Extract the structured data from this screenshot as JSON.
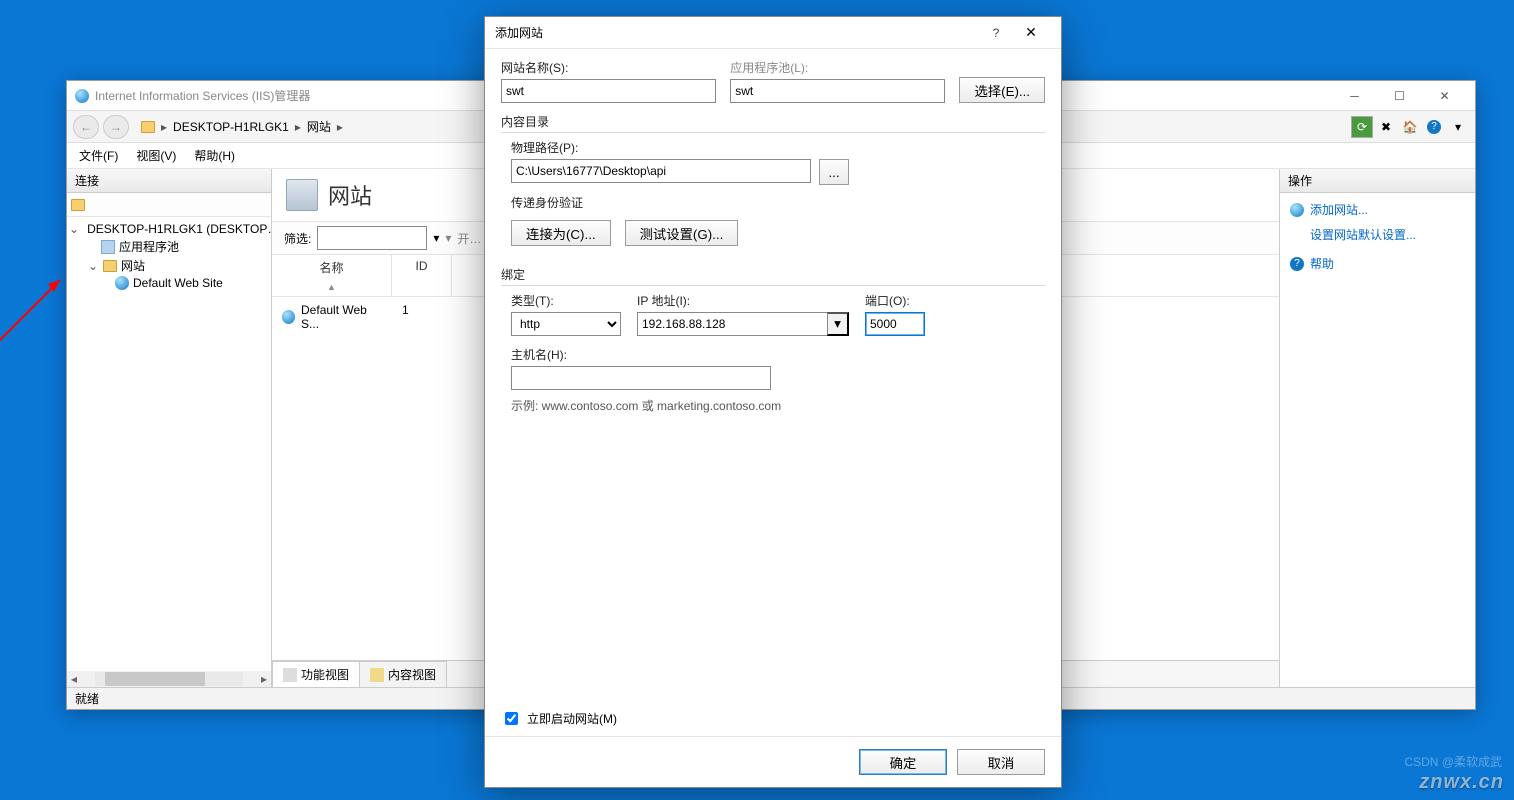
{
  "iis": {
    "title": "Internet Information Services (IIS)管理器",
    "breadcrumb": {
      "host": "DESKTOP-H1RLGK1",
      "node": "网站"
    },
    "menu": {
      "file": "文件(F)",
      "view": "视图(V)",
      "help": "帮助(H)"
    },
    "connections": {
      "header": "连接",
      "host": "DESKTOP-H1RLGK1 (DESKTOP…",
      "appPools": "应用程序池",
      "sites": "网站",
      "defaultSite": "Default Web Site"
    },
    "center": {
      "title": "网站",
      "filterLabel": "筛选:",
      "goLabel": "开…",
      "columns": {
        "name": "名称",
        "id": "ID"
      },
      "rows": [
        {
          "name": "Default Web S...",
          "id": "1"
        }
      ],
      "viewTabs": {
        "features": "功能视图",
        "content": "内容视图"
      }
    },
    "actions": {
      "header": "操作",
      "addSite": "添加网站...",
      "setDefaults": "设置网站默认设置...",
      "help": "帮助"
    },
    "status": "就绪"
  },
  "dialog": {
    "title": "添加网站",
    "siteNameLabel": "网站名称(S):",
    "siteName": "swt",
    "appPoolLabel": "应用程序池(L):",
    "appPool": "swt",
    "selectBtn": "选择(E)...",
    "contentGroup": "内容目录",
    "physPathLabel": "物理路径(P):",
    "physPath": "C:\\Users\\16777\\Desktop\\api",
    "browse": "...",
    "passthrough": "传递身份验证",
    "connectAs": "连接为(C)...",
    "testSettings": "测试设置(G)...",
    "bindingGroup": "绑定",
    "typeLabel": "类型(T):",
    "type": "http",
    "ipLabel": "IP 地址(I):",
    "ip": "192.168.88.128",
    "portLabel": "端口(O):",
    "port": "5000",
    "hostLabel": "主机名(H):",
    "host": "",
    "example": "示例: www.contoso.com 或 marketing.contoso.com",
    "startNow": "立即启动网站(M)",
    "ok": "确定",
    "cancel": "取消"
  },
  "watermark": "znwx.cn",
  "watermark2": "CSDN @柔软成武"
}
